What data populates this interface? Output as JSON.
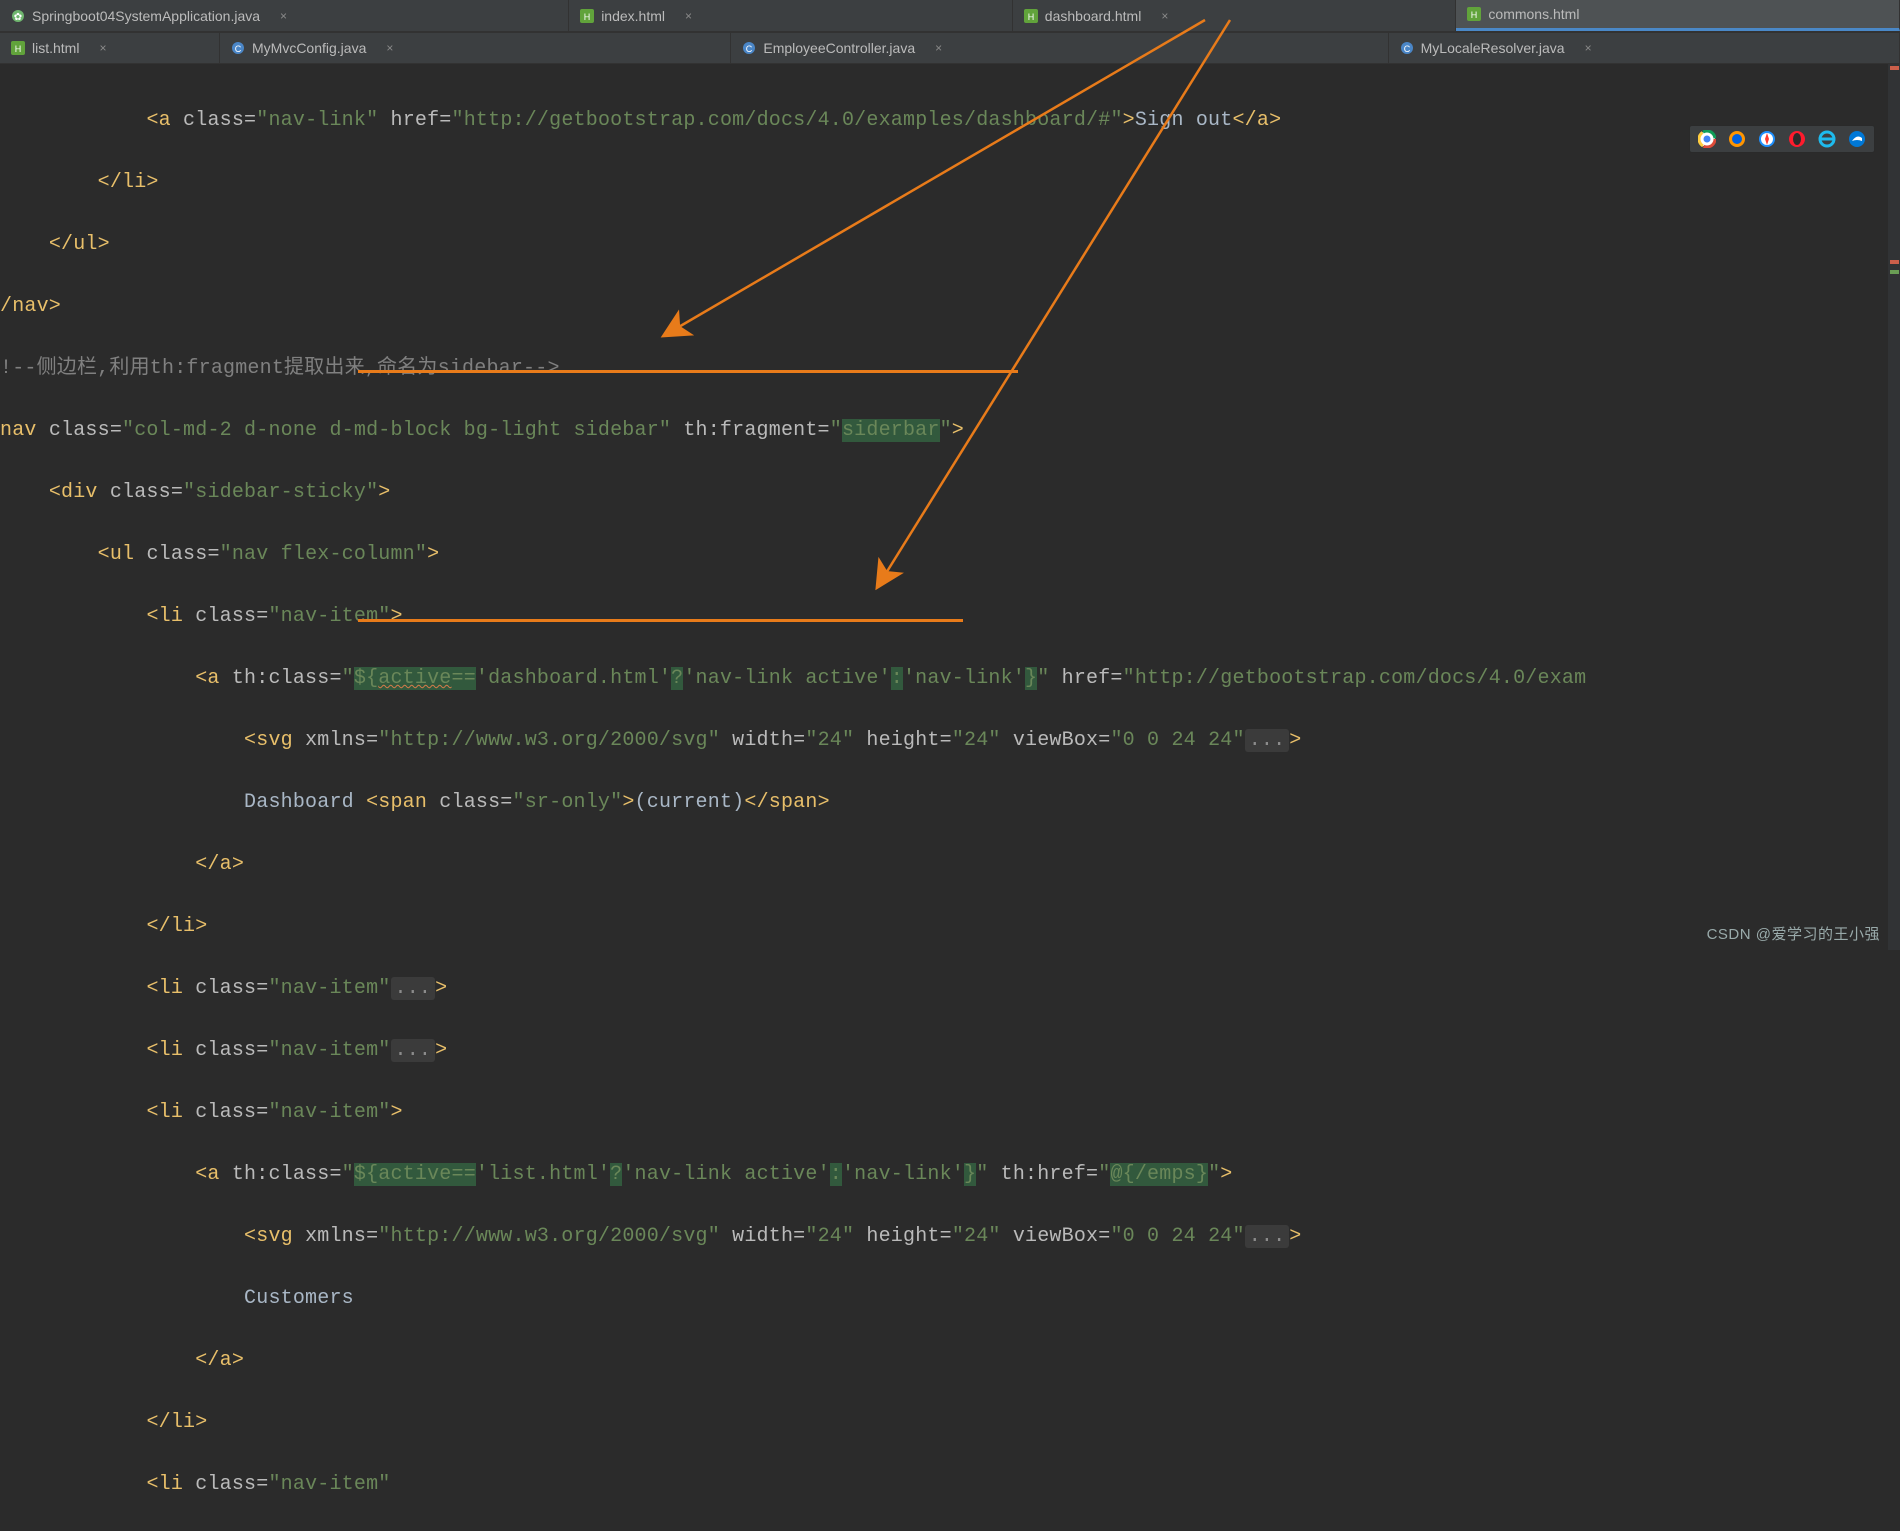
{
  "tabs_row1": [
    {
      "label": "Springboot04SystemApplication.java",
      "icon": "java",
      "active": false,
      "close": true
    },
    {
      "label": "index.html",
      "icon": "html",
      "active": false,
      "close": true
    },
    {
      "label": "dashboard.html",
      "icon": "html",
      "active": false,
      "close": true
    },
    {
      "label": "commons.html",
      "icon": "html",
      "active": true,
      "close": false
    }
  ],
  "tabs_row2": [
    {
      "label": "list.html",
      "icon": "html",
      "active": false,
      "close": true
    },
    {
      "label": "MyMvcConfig.java",
      "icon": "class",
      "active": false,
      "close": true
    },
    {
      "label": "EmployeeController.java",
      "icon": "class",
      "active": false,
      "close": true
    },
    {
      "label": "MyLocaleResolver.java",
      "icon": "class",
      "active": false,
      "close": true
    }
  ],
  "code": {
    "l1_href": "http://getbootstrap.com/docs/4.0/examples/dashboard/#",
    "l1_text": "Sign out",
    "comment": "!--侧边栏,利用th:fragment提取出来,命名为sidebar-->",
    "nav_class": "col-md-2 d-none d-md-block bg-light sidebar",
    "nav_frag": "siderbar",
    "div_class": "sidebar-sticky",
    "ul_class": "nav flex-column",
    "li_class": "nav-item",
    "expr1": "${active=='dashboard.html'?'nav-link active':'nav-link'}",
    "href2": "http://getbootstrap.com/docs/4.0/exam",
    "svg_xmlns": "http://www.w3.org/2000/svg",
    "svg_w": "24",
    "svg_h": "24",
    "svg_vb": "0 0 24 24",
    "dash_txt": "Dashboard ",
    "sr_class": "sr-only",
    "current": "(current)",
    "expr2": "${active=='list.html'?'nav-link active':'nav-link'}",
    "emps": "@{/emps}",
    "cust": "Customers"
  },
  "watermark": "CSDN @爱学习的王小强",
  "browser_icons": [
    "chrome",
    "firefox",
    "safari",
    "opera",
    "ie",
    "edge"
  ]
}
